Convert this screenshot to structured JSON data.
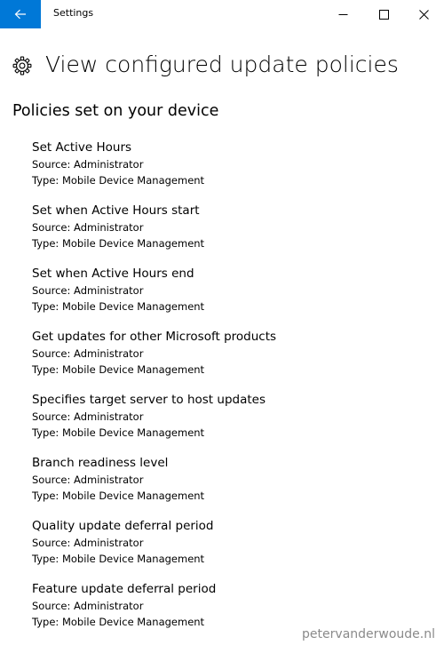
{
  "window": {
    "title": "Settings"
  },
  "header": {
    "title": "View configured update policies"
  },
  "section": {
    "title": "Policies set on your device"
  },
  "policies": [
    {
      "name": "Set Active Hours",
      "source": "Source: Administrator",
      "type": "Type: Mobile Device Management"
    },
    {
      "name": "Set when Active Hours start",
      "source": "Source: Administrator",
      "type": "Type: Mobile Device Management"
    },
    {
      "name": "Set when Active Hours end",
      "source": "Source: Administrator",
      "type": "Type: Mobile Device Management"
    },
    {
      "name": "Get updates for other Microsoft products",
      "source": "Source: Administrator",
      "type": "Type: Mobile Device Management"
    },
    {
      "name": "Specifies target server to host updates",
      "source": "Source: Administrator",
      "type": "Type: Mobile Device Management"
    },
    {
      "name": "Branch readiness level",
      "source": "Source: Administrator",
      "type": "Type: Mobile Device Management"
    },
    {
      "name": "Quality update deferral period",
      "source": "Source: Administrator",
      "type": "Type: Mobile Device Management"
    },
    {
      "name": "Feature update deferral period",
      "source": "Source: Administrator",
      "type": "Type: Mobile Device Management"
    }
  ],
  "watermark": "petervanderwoude.nl",
  "icons": {
    "back": "back-arrow-icon",
    "minimize": "minimize-icon",
    "maximize": "maximize-icon",
    "close": "close-icon",
    "page": "gear-icon"
  },
  "colors": {
    "accent": "#0078d7",
    "text": "#000000",
    "watermark": "#8a8a8a"
  }
}
